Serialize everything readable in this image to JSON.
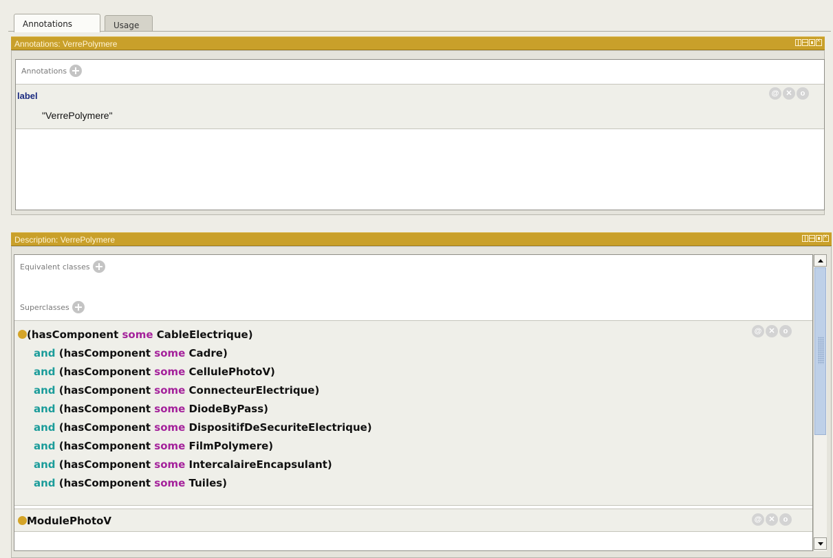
{
  "tabs": [
    {
      "label": "Annotations"
    },
    {
      "label": "Usage"
    }
  ],
  "annotations_panel": {
    "title": "Annotations: VerrePolymere",
    "section_label": "Annotations",
    "entry": {
      "property": "label",
      "value": "\"VerrePolymere\""
    }
  },
  "description_panel": {
    "title": "Description: VerrePolymere",
    "equivalent_label": "Equivalent classes",
    "superclasses_label": "Superclasses",
    "superclass_expression": [
      {
        "prefix": "",
        "open": "(hasComponent ",
        "some": "some",
        "target": " CableElectrique)"
      },
      {
        "prefix": "and",
        "open": " (hasComponent ",
        "some": "some",
        "target": " Cadre)"
      },
      {
        "prefix": "and",
        "open": " (hasComponent ",
        "some": "some",
        "target": " CellulePhotoV)"
      },
      {
        "prefix": "and",
        "open": " (hasComponent ",
        "some": "some",
        "target": " ConnecteurElectrique)"
      },
      {
        "prefix": "and",
        "open": " (hasComponent ",
        "some": "some",
        "target": " DiodeByPass)"
      },
      {
        "prefix": "and",
        "open": " (hasComponent ",
        "some": "some",
        "target": " DispositifDeSecuriteElectrique)"
      },
      {
        "prefix": "and",
        "open": " (hasComponent ",
        "some": "some",
        "target": " FilmPolymere)"
      },
      {
        "prefix": "and",
        "open": " (hasComponent ",
        "some": "some",
        "target": " IntercalaireEncapsulant)"
      },
      {
        "prefix": "and",
        "open": " (hasComponent ",
        "some": "some",
        "target": " Tuiles)"
      }
    ],
    "second_superclass": "ModulePhotoV"
  },
  "entry_actions": {
    "annotate": "@",
    "delete": "✕",
    "edit": "o"
  },
  "colors": {
    "header": "#c9a02a",
    "and_keyword": "#1b9c9a",
    "some_keyword": "#a4229b",
    "class_bullet": "#d4a428"
  }
}
